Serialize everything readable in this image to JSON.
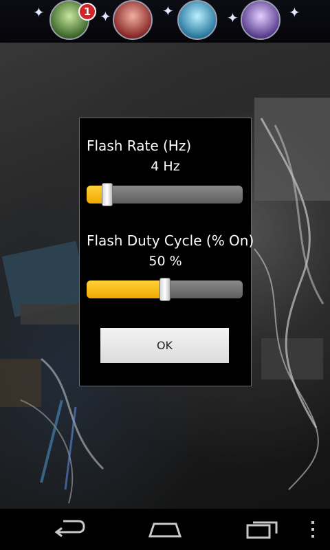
{
  "topbar": {
    "avatars": [
      "character-1",
      "character-2",
      "character-3",
      "character-4"
    ],
    "notification_count": "1"
  },
  "dialog": {
    "flash_rate_label": "Flash Rate (Hz)",
    "flash_rate_value": "4 Hz",
    "flash_rate_fraction": 0.13,
    "duty_cycle_label": "Flash Duty Cycle (% On)",
    "duty_cycle_value": "50 %",
    "duty_cycle_fraction": 0.5,
    "ok_label": "OK"
  },
  "navbar": {
    "icons": [
      "back-icon",
      "home-icon",
      "recent-apps-icon",
      "overflow-menu-icon"
    ]
  },
  "colors": {
    "slider_fill": "#ffc515",
    "dialog_background": "#000000"
  }
}
